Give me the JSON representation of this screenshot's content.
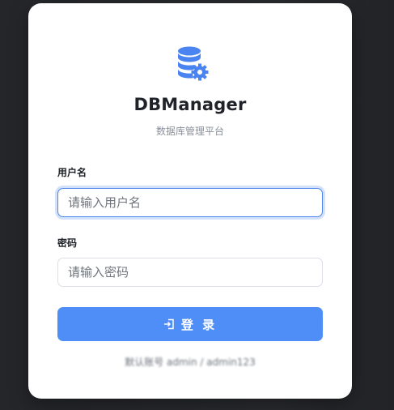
{
  "app": {
    "title": "DBManager",
    "subtitle": "数据库管理平台"
  },
  "form": {
    "username_label": "用户名",
    "username_placeholder": "请输入用户名",
    "username_value": "",
    "password_label": "密码",
    "password_placeholder": "请输入密码",
    "password_value": "",
    "submit_label": "登 录"
  },
  "footer": {
    "hint": "默认账号 admin / admin123"
  },
  "icons": {
    "logo": "database-gear-icon",
    "submit": "login-icon"
  },
  "colors": {
    "accent": "#4f8ef7",
    "focus_border": "#4e86ec",
    "background": "#26272b",
    "card": "#ffffff"
  }
}
